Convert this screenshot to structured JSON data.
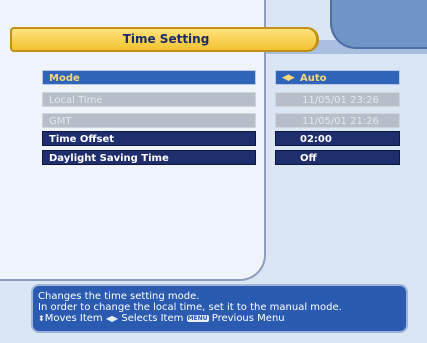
{
  "title": "Time Setting",
  "menu": [
    {
      "label": "Mode",
      "value": "Auto",
      "state": "selected"
    },
    {
      "label": "Local Time",
      "value": "11/05/01 23:26",
      "state": "disabled"
    },
    {
      "label": "GMT",
      "value": "11/05/01 21:26",
      "state": "disabled"
    },
    {
      "label": "Time Offset",
      "value": "02:00",
      "state": "normal"
    },
    {
      "label": "Daylight Saving Time",
      "value": "Off",
      "state": "normal"
    }
  ],
  "help": {
    "line1": "Changes the time setting mode.",
    "line2": "In order to change the local time, set it to the manual mode.",
    "moves_label": "Moves Item",
    "selects_label": "Selects Item",
    "menu_key_label": "MENU",
    "previous_label": "Previous Menu"
  },
  "colors": {
    "title_bar": "#f2c230",
    "selected_row": "#2f64b8",
    "normal_row": "#1f2e6c",
    "disabled_row": "#b6bec9",
    "help_panel": "#2a5bb0"
  },
  "icons": {
    "updown": "up-down-arrows-icon",
    "leftright": "left-right-arrows-icon",
    "menu": "menu-key-icon"
  }
}
